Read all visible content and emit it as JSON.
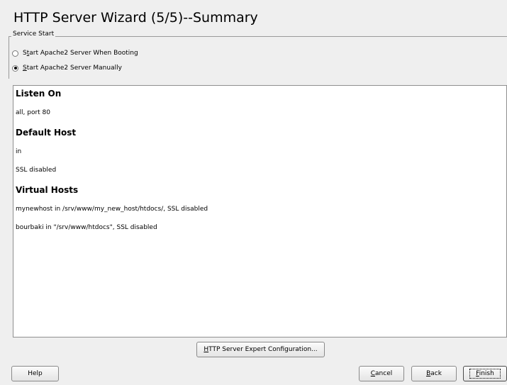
{
  "header": {
    "title": "HTTP Server Wizard (5/5)--Summary"
  },
  "service_start": {
    "group_label": "Service Start",
    "options": [
      {
        "prefix": "S",
        "mnemonic": "t",
        "rest": "art Apache2 Server When Booting",
        "selected": false
      },
      {
        "prefix": "",
        "mnemonic": "S",
        "rest": "tart Apache2 Server Manually",
        "selected": true
      }
    ]
  },
  "summary": {
    "sections": [
      {
        "heading": "Listen On",
        "lines": [
          "all, port 80"
        ]
      },
      {
        "heading": "Default Host",
        "lines": [
          "in",
          "SSL disabled"
        ]
      },
      {
        "heading": "Virtual Hosts",
        "lines": [
          "mynewhost in /srv/www/my_new_host/htdocs/, SSL disabled",
          "bourbaki in \"/srv/www/htdocs\", SSL disabled"
        ]
      }
    ]
  },
  "buttons": {
    "expert": {
      "mnemonic": "H",
      "rest": "TTP Server Expert Configuration..."
    },
    "help": {
      "label": "Help"
    },
    "cancel": {
      "mnemonic": "C",
      "rest": "ancel"
    },
    "back": {
      "mnemonic": "B",
      "rest": "ack"
    },
    "finish": {
      "mnemonic": "F",
      "rest": "inish"
    }
  }
}
